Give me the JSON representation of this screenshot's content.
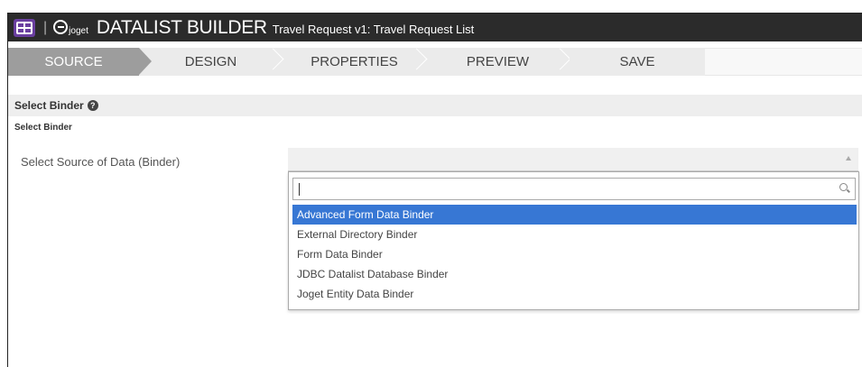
{
  "header": {
    "logo_text": "joget",
    "title": "DATALIST BUILDER",
    "subtitle": "Travel Request v1: Travel Request List"
  },
  "steps": [
    {
      "label": "SOURCE",
      "active": true
    },
    {
      "label": "DESIGN",
      "active": false
    },
    {
      "label": "PROPERTIES",
      "active": false
    },
    {
      "label": "PREVIEW",
      "active": false
    },
    {
      "label": "SAVE",
      "active": false
    }
  ],
  "section": {
    "title": "Select Binder",
    "sub_label": "Select Binder",
    "field_label": "Select Source of Data (Binder)"
  },
  "binder_select": {
    "value": "",
    "search_value": "",
    "options": [
      "Advanced Form Data Binder",
      "External Directory Binder",
      "Form Data Binder",
      "JDBC Datalist Database Binder",
      "Joget Entity Data Binder"
    ],
    "highlighted_index": 0
  },
  "colors": {
    "header_bg": "#2b2b2b",
    "app_icon": "#6a3fa0",
    "active_step": "#9d9d9d",
    "highlight": "#3777d4"
  }
}
